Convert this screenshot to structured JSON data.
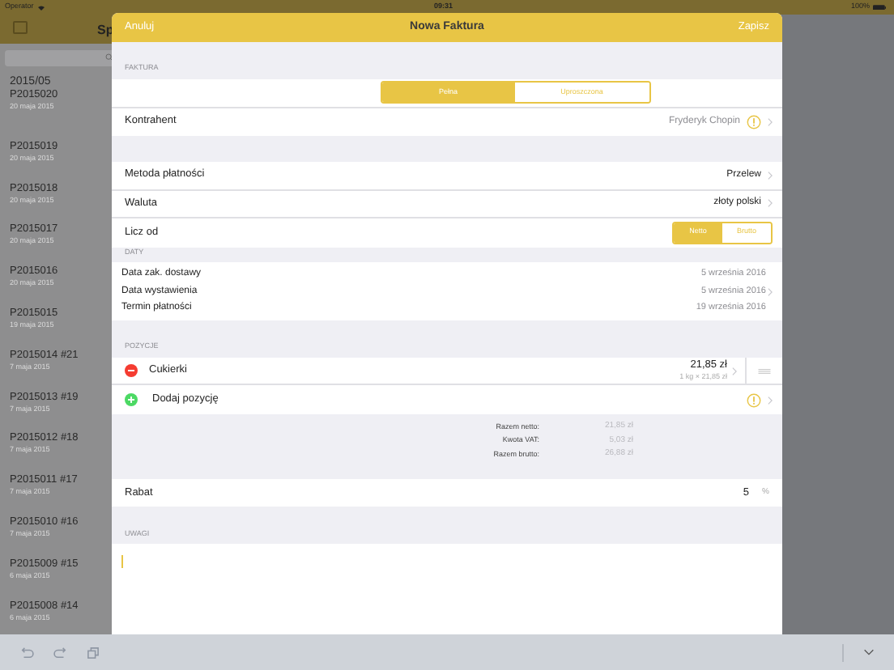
{
  "status_bar": {
    "carrier": "Operator",
    "time": "09:31",
    "battery": "100%"
  },
  "sidebar": {
    "title": "Sp",
    "section": "2015/05",
    "items": [
      {
        "number": "P2015020",
        "date": "20 maja 2015"
      },
      {
        "number": "P2015019",
        "date": "20 maja 2015"
      },
      {
        "number": "P2015018",
        "date": "20 maja 2015"
      },
      {
        "number": "P2015017",
        "date": "20 maja 2015"
      },
      {
        "number": "P2015016",
        "date": "20 maja 2015"
      },
      {
        "number": "P2015015",
        "date": "19 maja 2015"
      },
      {
        "number": "P2015014 #21",
        "date": "7 maja 2015"
      },
      {
        "number": "P2015013 #19",
        "date": "7 maja 2015"
      },
      {
        "number": "P2015012 #18",
        "date": "7 maja 2015"
      },
      {
        "number": "P2015011 #17",
        "date": "7 maja 2015"
      },
      {
        "number": "P2015010 #16",
        "date": "7 maja 2015"
      },
      {
        "number": "P2015009 #15",
        "date": "6 maja 2015"
      },
      {
        "number": "P2015008 #14",
        "date": "6 maja 2015"
      }
    ]
  },
  "modal": {
    "title": "Nowa Faktura",
    "cancel": "Anuluj",
    "save": "Zapisz",
    "faktura": {
      "heading": "FAKTURA",
      "types": [
        {
          "label": "Pełna",
          "selected": true
        },
        {
          "label": "Uproszczona",
          "selected": false
        }
      ],
      "contractor_label": "Kontrahent",
      "contractor": "Fryderyk Chopin"
    },
    "payment": [
      {
        "label": "Metoda płatności",
        "value": "Przelew"
      },
      {
        "label": "Waluta",
        "value": "złoty polski"
      }
    ],
    "licz_od": {
      "label": "Licz od",
      "options": [
        {
          "label": "Netto",
          "selected": true
        },
        {
          "label": "Brutto",
          "selected": false
        }
      ]
    },
    "daty": {
      "heading": "DATY",
      "rows": [
        {
          "label": "Data zak. dostawy",
          "value": "5 września 2016",
          "chevron": false
        },
        {
          "label": "Data wystawienia",
          "value": "5 września 2016",
          "chevron": true
        },
        {
          "label": "Termin płatności",
          "value": "19 września 2016",
          "chevron": false
        }
      ]
    },
    "pozycje": {
      "heading": "POZYCJE",
      "items": [
        {
          "name": "Cukierki",
          "total": "21,85 zł",
          "detail": "1 kg × 21,85 zł"
        }
      ],
      "add_label": "Dodaj pozycję",
      "totals": [
        {
          "label": "Razem netto:",
          "value": "21,85 zł"
        },
        {
          "label": "Kwota VAT:",
          "value": "5,03 zł"
        },
        {
          "label": "Razem brutto:",
          "value": "26,88 zł"
        }
      ]
    },
    "rabat": {
      "label": "Rabat",
      "value": "5",
      "unit": "%"
    },
    "uwagi": {
      "heading": "UWAGI"
    }
  }
}
